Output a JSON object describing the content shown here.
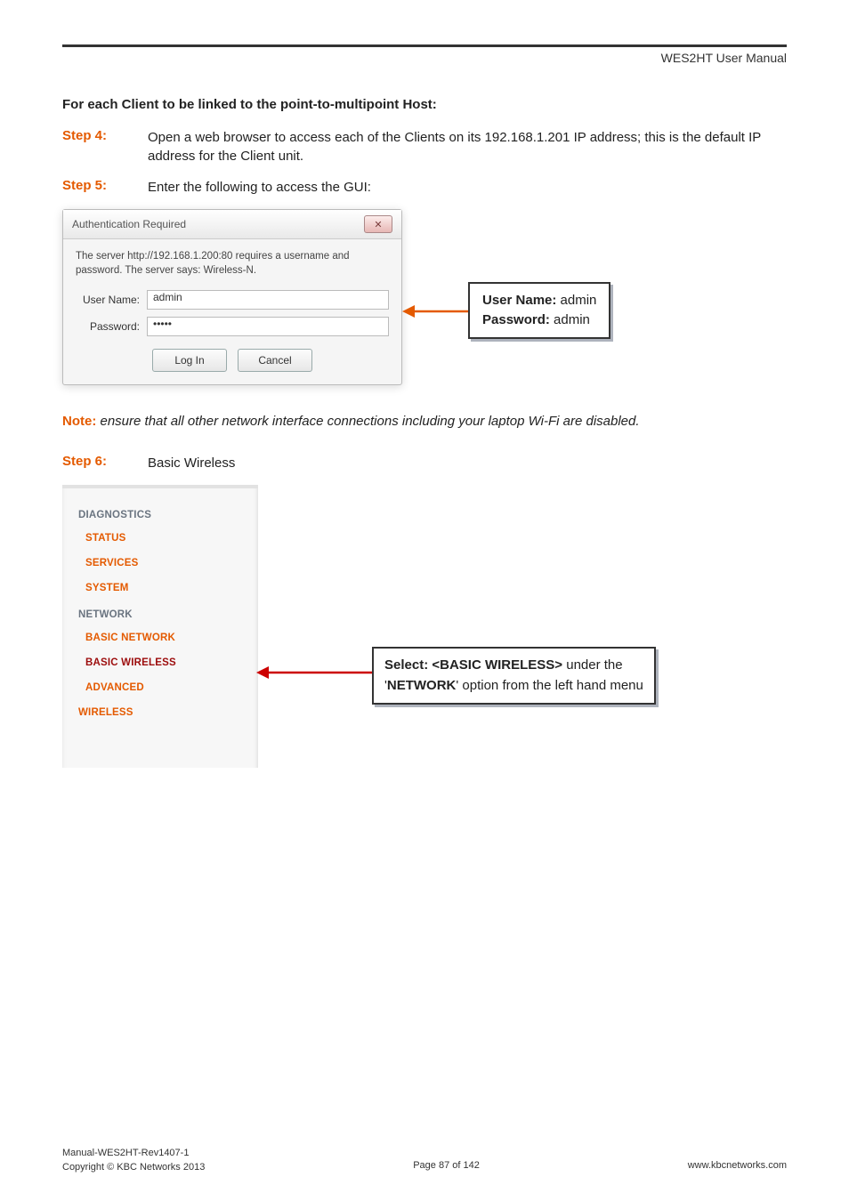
{
  "header": {
    "doc_title": "WES2HT User Manual"
  },
  "section_heading": "For each Client to be linked to the point-to-multipoint Host:",
  "step4": {
    "label": "Step 4:",
    "body": "Open a web browser to access each of the Clients on its 192.168.1.201 IP address; this is the default IP address for the Client unit."
  },
  "step5": {
    "label": "Step 5:",
    "body": "Enter the following to access the GUI:"
  },
  "auth_dialog": {
    "title": "Authentication Required",
    "close_glyph": "✕",
    "message": "The server http://192.168.1.200:80 requires a username and password. The server says: Wireless-N.",
    "username_label": "User Name:",
    "username_value": "admin",
    "password_label": "Password:",
    "password_value": "•••••",
    "login_btn": "Log In",
    "cancel_btn": "Cancel"
  },
  "callout1": {
    "l1a": "User Name:",
    "l1b": " admin",
    "l2a": "Password:",
    "l2b": " admin"
  },
  "note": {
    "label": "Note:",
    "body": " ensure that all other network interface connections including your laptop Wi-Fi are disabled."
  },
  "step6": {
    "label": "Step 6:",
    "body": "Basic Wireless"
  },
  "sidebar": {
    "diag_head": "DIAGNOSTICS",
    "items": {
      "status": "STATUS",
      "services": "SERVICES",
      "system": "SYSTEM"
    },
    "net_head": "NETWORK",
    "net_items": {
      "basic_network": "BASIC NETWORK",
      "basic_wireless": "BASIC WIRELESS",
      "advanced": "ADVANCED"
    },
    "wireless": "WIRELESS"
  },
  "callout2": {
    "l1a": "Select:  ",
    "l1b": "<BASIC WIRELESS>",
    "l1c": " under the",
    "l2a": "'",
    "l2b": "NETWORK",
    "l2c": "' option from the left hand menu"
  },
  "footer": {
    "left1": "Manual-WES2HT-Rev1407-1",
    "left2": "Copyright © KBC Networks 2013",
    "center": "Page 87 of 142",
    "right": "www.kbcnetworks.com"
  }
}
